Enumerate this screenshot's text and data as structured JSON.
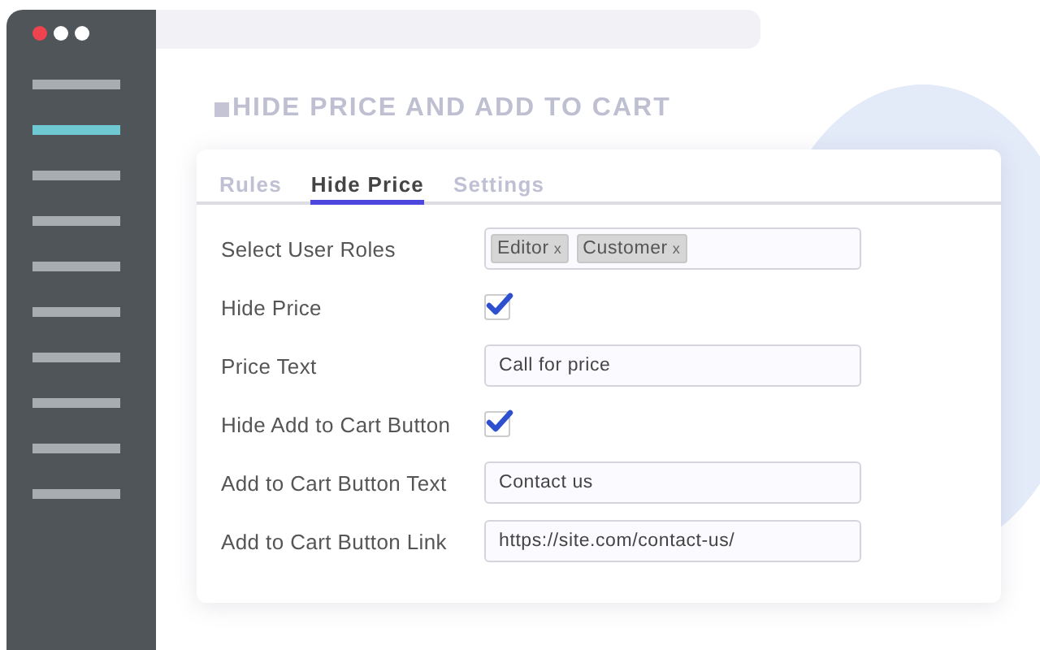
{
  "sidebar": {
    "items": [
      {
        "selected": false
      },
      {
        "selected": true
      },
      {
        "selected": false
      },
      {
        "selected": false
      },
      {
        "selected": false
      },
      {
        "selected": false
      },
      {
        "selected": false
      },
      {
        "selected": false
      },
      {
        "selected": false
      },
      {
        "selected": false
      }
    ]
  },
  "page": {
    "title": "HIDE PRICE AND ADD TO CART"
  },
  "tabs": [
    {
      "label": "Rules",
      "selected": false
    },
    {
      "label": "Hide Price",
      "selected": true
    },
    {
      "label": "Settings",
      "selected": false
    }
  ],
  "form": [
    {
      "kind": "tags",
      "label": "Select User Roles",
      "tags": [
        {
          "text": "Editor",
          "remove": "x"
        },
        {
          "text": "Customer",
          "remove": "x"
        }
      ]
    },
    {
      "kind": "checkbox",
      "label": "Hide Price",
      "checked": true
    },
    {
      "kind": "text",
      "label": "Price Text",
      "value": "Call for price"
    },
    {
      "kind": "checkbox",
      "label": "Hide Add to Cart Button",
      "checked": true
    },
    {
      "kind": "text",
      "label": "Add to Cart Button Text",
      "value": "Contact us"
    },
    {
      "kind": "text",
      "label": "Add to Cart Button Link",
      "value": "https://site.com/contact-us/"
    }
  ]
}
